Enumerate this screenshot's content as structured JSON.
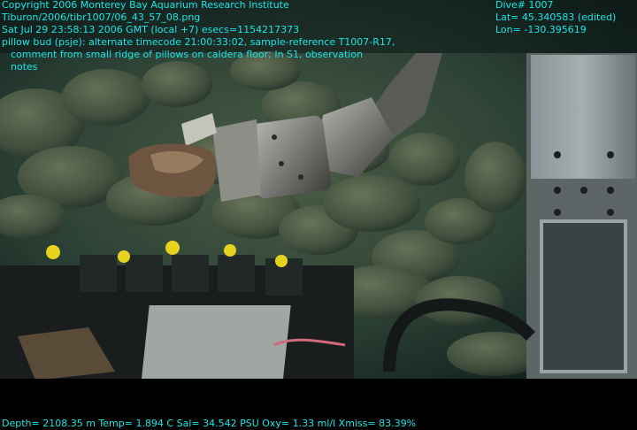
{
  "overlay": {
    "copyright": "Copyright 2006 Monterey Bay Aquarium Research Institute",
    "file_path": "Tiburon/2006/tibr1007/06_43_57_08.png",
    "datetime": "Sat Jul 29 23:58:13 2006 GMT (local +7)  esecs=1154217373",
    "annotation_line1": "pillow bud (psje): alternate timecode 21:00:33:02, sample-reference T1007-R17,",
    "annotation_line2": "comment from small ridge of pillows on caldera floor; In S1, observation",
    "annotation_line3": "notes",
    "dive": "Dive# 1007",
    "lat": "Lat= 45.340583 (edited)",
    "lon": "Lon= -130.395619"
  },
  "telemetry": "Depth= 2108.35 m  Temp= 1.894 C  Sal= 34.542 PSU  Oxy= 1.33 ml/l  Xmiss= 83.39%",
  "colors": {
    "overlay_text": "#18e6e6",
    "water": "#1f3a32",
    "pillow_lava": "#4a5a45"
  }
}
